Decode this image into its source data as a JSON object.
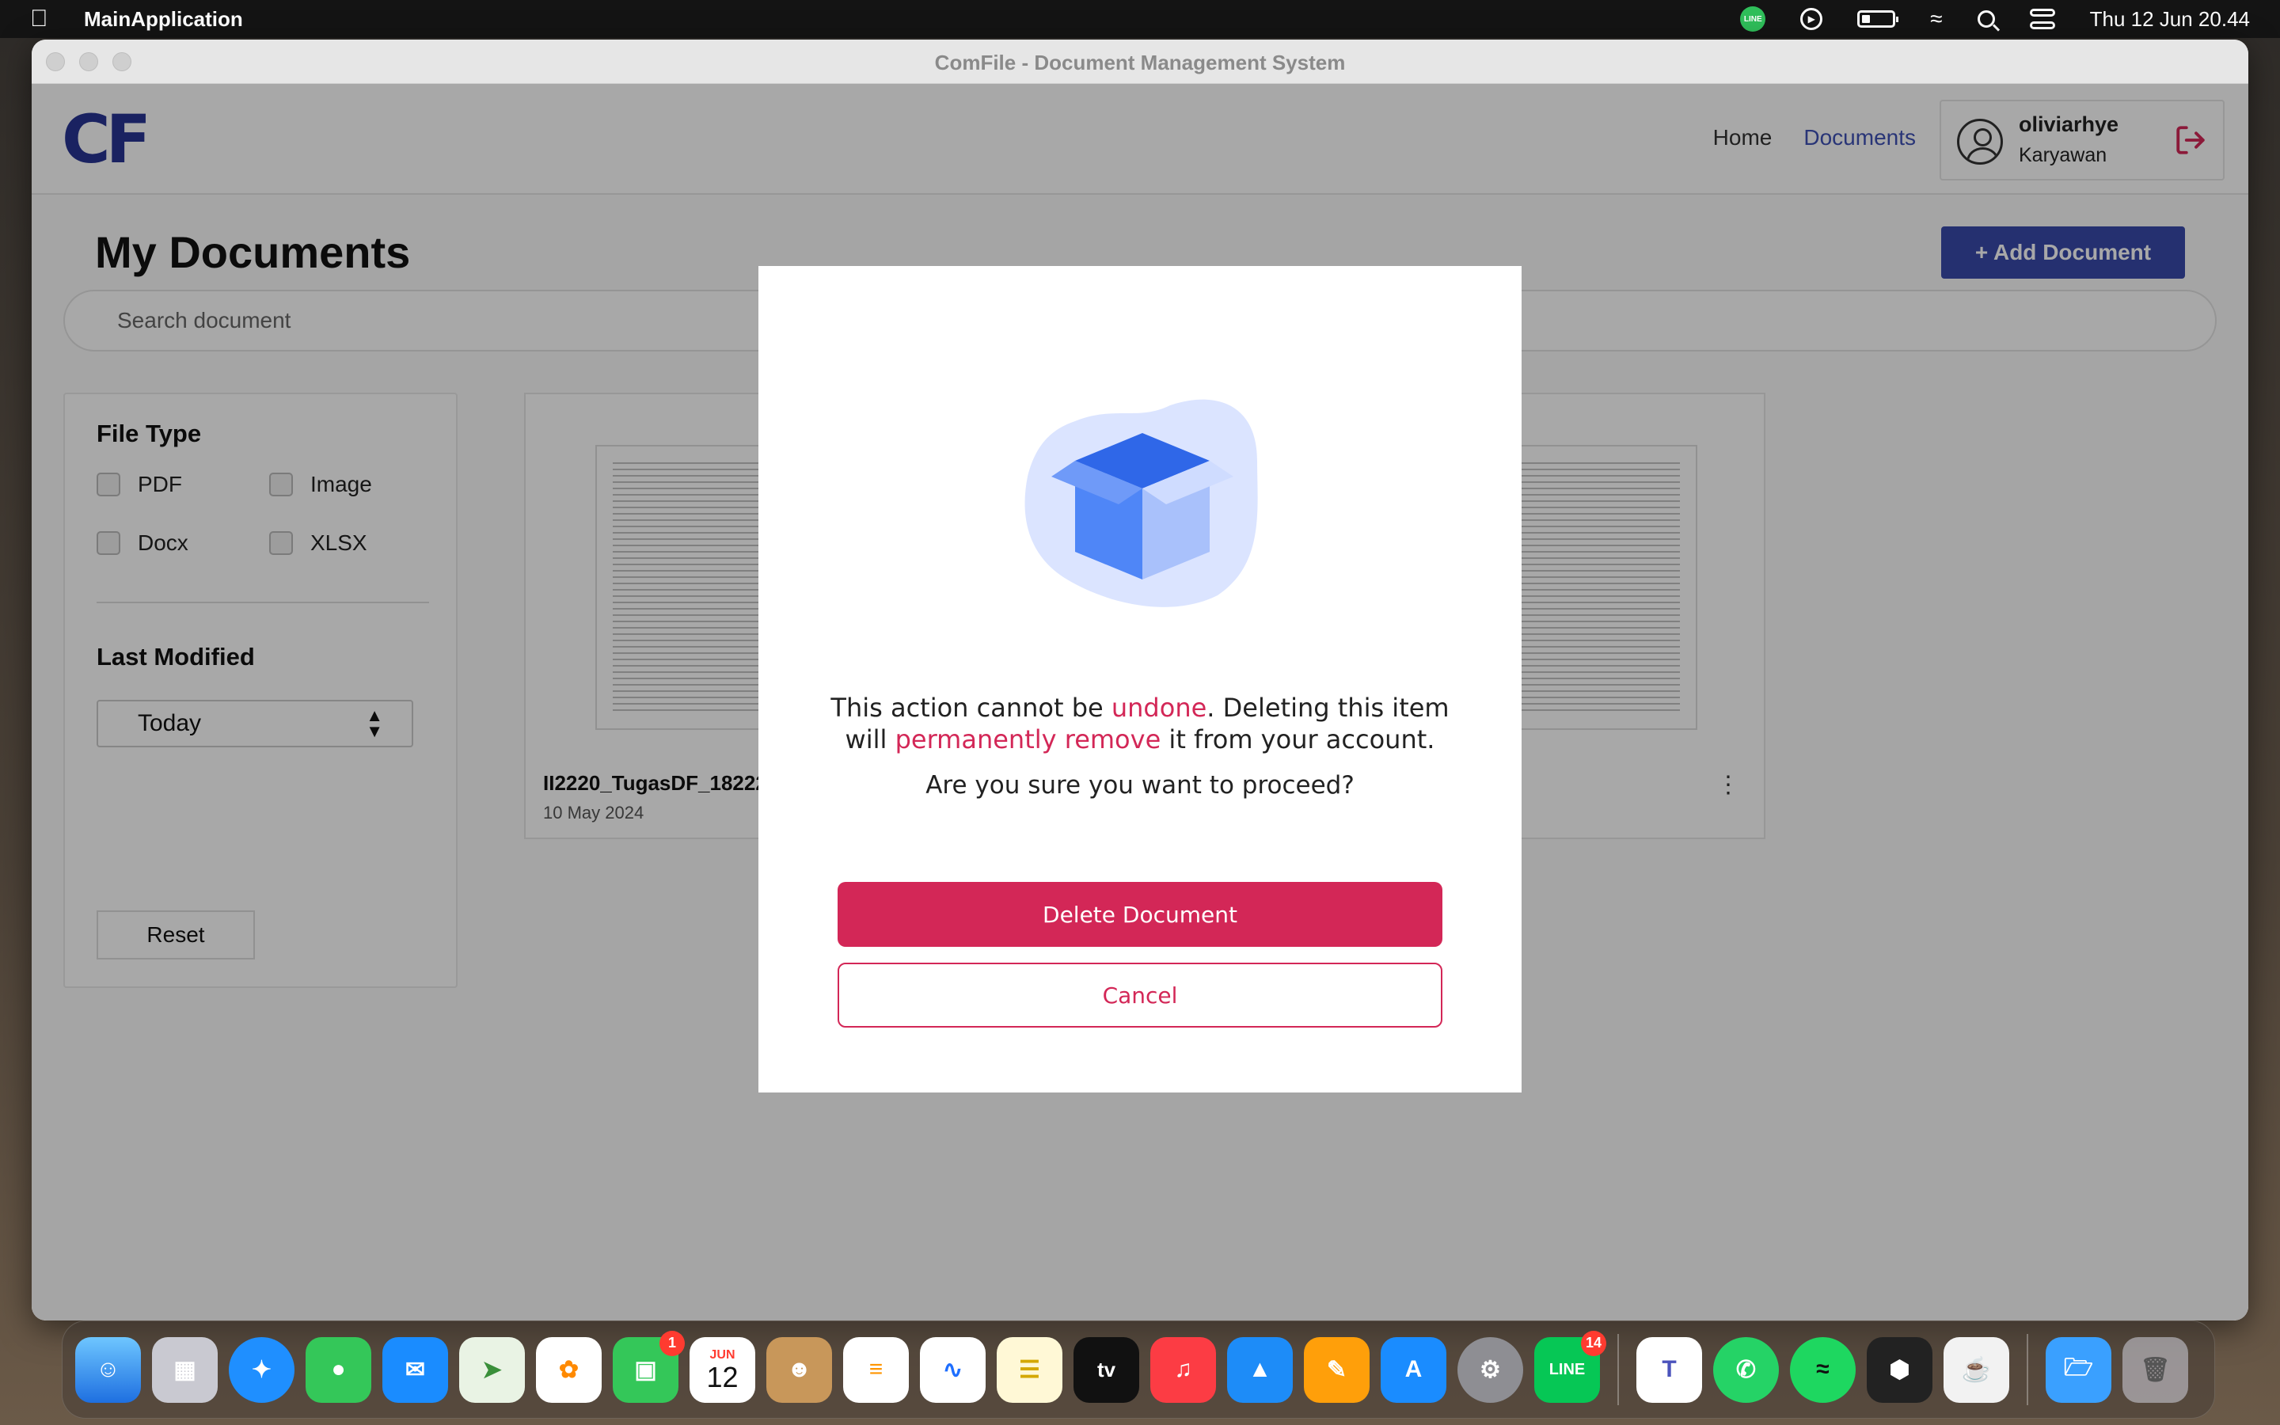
{
  "menubar": {
    "app_name": "MainApplication",
    "clock": "Thu 12 Jun  20.44",
    "line_label": "LINE"
  },
  "window": {
    "title": "ComFile - Document Management System"
  },
  "header": {
    "logo": "CF",
    "nav": {
      "home": "Home",
      "documents": "Documents"
    },
    "user": {
      "name": "oliviarhye",
      "role": "Karyawan"
    }
  },
  "page": {
    "title": "My Documents",
    "add_button": "+ Add Document",
    "search_placeholder": "Search document"
  },
  "filters": {
    "file_type_heading": "File Type",
    "types": [
      "PDF",
      "Image",
      "Docx",
      "XLSX"
    ],
    "last_modified_heading": "Last Modified",
    "last_modified_value": "Today",
    "reset_label": "Reset"
  },
  "documents": [
    {
      "name": "II2220_TugasDF_18222",
      "date": "10 May 2024"
    }
  ],
  "modal": {
    "line1_a": "This action cannot be ",
    "line1_hl": "undone",
    "line1_b": ". Deleting this item",
    "line2_a": "will ",
    "line2_hl": "permanently remove",
    "line2_b": " it from your account.",
    "question": "Are you sure you want to proceed?",
    "delete_label": "Delete Document",
    "cancel_label": "Cancel"
  },
  "colors": {
    "accent": "#3949ab",
    "danger": "#d32757",
    "link": "#3f51b5"
  },
  "dock": {
    "calendar_month": "JUN",
    "calendar_day": "12",
    "facetime_badge": "1",
    "line_badge": "14",
    "tv_label": "tv",
    "line_label": "LINE"
  }
}
